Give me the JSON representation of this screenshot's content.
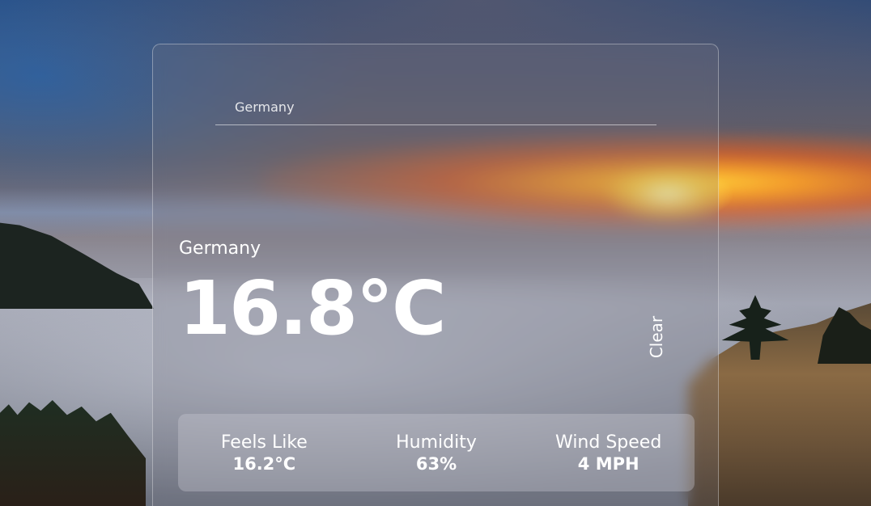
{
  "search": {
    "value": "",
    "placeholder": "Germany"
  },
  "weather": {
    "location": "Germany",
    "temperature": "16.8°C",
    "condition": "Clear"
  },
  "stats": [
    {
      "label": "Feels Like",
      "value": "16.2°C"
    },
    {
      "label": "Humidity",
      "value": "63%"
    },
    {
      "label": "Wind Speed",
      "value": "4 MPH"
    }
  ],
  "colors": {
    "text": "#ffffff",
    "card_border": "#ffffff",
    "sun_glow": "#ffd63c",
    "sunset_orange": "#e15f23"
  }
}
